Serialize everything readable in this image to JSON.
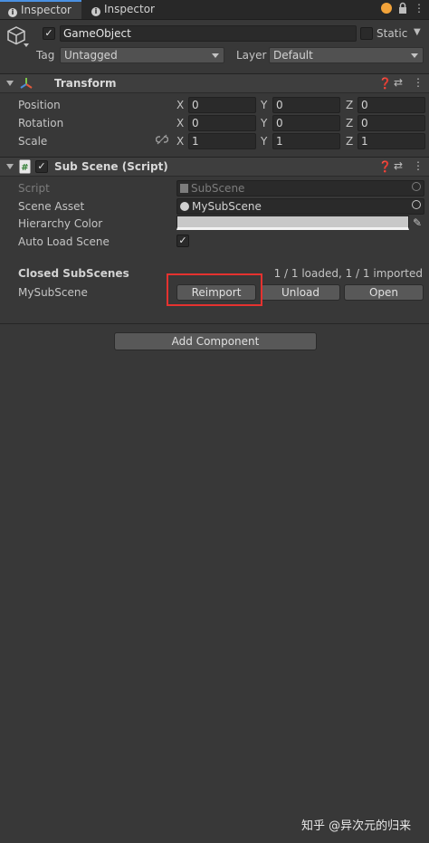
{
  "tabs": [
    {
      "label": "Inspector",
      "active": true
    },
    {
      "label": "Inspector",
      "active": false
    }
  ],
  "object": {
    "active": true,
    "name": "GameObject",
    "static_label": "Static",
    "tag_label": "Tag",
    "tag_value": "Untagged",
    "layer_label": "Layer",
    "layer_value": "Default"
  },
  "transform": {
    "title": "Transform",
    "rows": [
      {
        "label": "Position",
        "x": "0",
        "y": "0",
        "z": "0"
      },
      {
        "label": "Rotation",
        "x": "0",
        "y": "0",
        "z": "0"
      },
      {
        "label": "Scale",
        "x": "1",
        "y": "1",
        "z": "1"
      }
    ],
    "axes": [
      "X",
      "Y",
      "Z"
    ]
  },
  "subscene": {
    "title": "Sub Scene (Script)",
    "script_label": "Script",
    "script_value": "SubScene",
    "scene_asset_label": "Scene Asset",
    "scene_asset_value": "MySubScene",
    "hierarchy_color_label": "Hierarchy Color",
    "hierarchy_color": "#c8c8c8",
    "auto_load_label": "Auto Load Scene",
    "auto_load_checked": true,
    "closed_label": "Closed SubScenes",
    "status": "1 / 1 loaded, 1 / 1 imported",
    "item_name": "MySubScene",
    "reimport": "Reimport",
    "unload": "Unload",
    "open": "Open"
  },
  "add_component": "Add Component",
  "watermark": "知乎 @异次元的归来",
  "colors": {
    "background": "#383838",
    "highlight": "#e5322f",
    "tab_accent": "#4a90e2"
  }
}
